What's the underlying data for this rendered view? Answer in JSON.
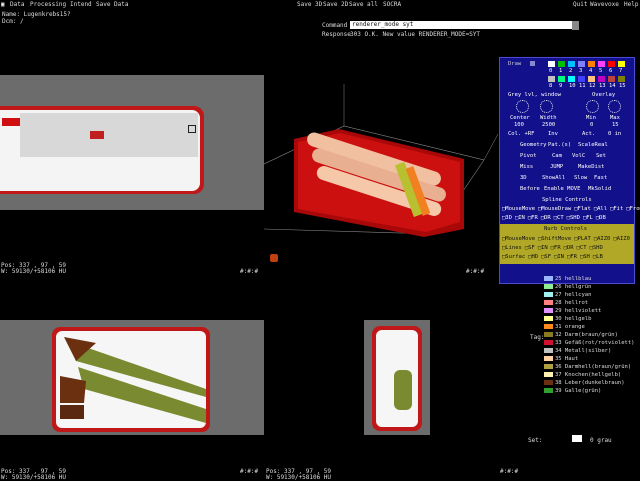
{
  "menu": {
    "left_items": [
      "Data",
      "Processing",
      "Intend",
      "Save Data"
    ],
    "center_items": [
      "Save 3D",
      "Save 2D",
      "Save all",
      "SOCRA"
    ],
    "right_items": [
      "Quit",
      "Wavevoxe",
      "Help"
    ]
  },
  "top_left_info": [
    "Name: Lugenkrebs15?",
    "Dcm: /"
  ],
  "command": {
    "label": "Command",
    "value": "renderer_mode syt",
    "response_label": "Response",
    "response_value": "303 O.K. New value RENDERER_MODE=SYT"
  },
  "status": {
    "topleft_pos": "Pos: 337 , 97 , 59",
    "topleft_w": "W: 59130/+58106 HU",
    "bottomleft_pos": "Pos: 337 , 97 , 59",
    "bottomleft_w": "W: 59130/+58106 HU",
    "bottommid_pos": "Pos: 337 , 97 , 59",
    "bottommid_w": "W: 59130/+58106 HU",
    "corner_tl": "#:#:#",
    "corner_3d": "#:#:#",
    "corner_bm": "#:#:#",
    "corner_br": "#:#:#"
  },
  "control_panel": {
    "draw_label": "Draw",
    "palette_numbers_row1": [
      "0",
      "1",
      "2",
      "3",
      "4",
      "5",
      "6",
      "7"
    ],
    "palette_numbers_row2": [
      "8",
      "9",
      "10",
      "11",
      "12",
      "13",
      "14",
      "15"
    ],
    "palette_colors": [
      "#ffffff",
      "#00c000",
      "#00c0ff",
      "#8080ff",
      "#ff8000",
      "#ff40ff",
      "#ff0000",
      "#ffff00",
      "#c0c0c0",
      "#00ff80",
      "#00ffff",
      "#4040ff",
      "#ffc080",
      "#c000c0",
      "#c04040",
      "#808000"
    ],
    "grey_label": "Grey lvl, window",
    "overlay_label": "Overlay",
    "center_label": "Center",
    "width_label": "Width",
    "min_label": "Min",
    "max_label": "Max",
    "center_value": "100",
    "width_value": "2500",
    "min_value": "0",
    "max_value": "15",
    "col_label": "Col. +RF",
    "inv_label": "Inv",
    "act_label": "Act.",
    "oin_label": "0 in",
    "geometry_label": "Geometry",
    "pat_label": "Pat.(s)",
    "scalereal_label": "ScaleReal",
    "row1": [
      "Pivot",
      "Cam",
      "VolC",
      "Set"
    ],
    "row2": [
      "Miss",
      "JUMP",
      "MakeDist"
    ],
    "row3": [
      "3D",
      "ShowAll",
      "Slow",
      "Fast"
    ],
    "row4": [
      "Before",
      "Enable MOVE",
      "MkSolid"
    ],
    "spline_label": "Spline Controls",
    "spline_row1": [
      "MouseMove",
      "MouseDraw",
      "Flat",
      "All",
      "Fit",
      "FromCut"
    ],
    "spline_row2": [
      "3D",
      "IN",
      "FR",
      "DR",
      "CT",
      "SHD",
      "FL",
      "DB"
    ],
    "nurb_label": "Nurb Controls",
    "nurb_row1": [
      "MouseMove",
      "ShiftMove",
      "PLAT",
      "AIZ0",
      "AIZ0"
    ],
    "nurb_row2": [
      "Lines",
      "SF",
      "IN",
      "FR",
      "DR",
      "CT",
      "SHD"
    ],
    "nurb_row3": [
      "Surfac",
      "HD",
      "SF",
      "IN",
      "FR",
      "SH",
      "LB"
    ]
  },
  "legend": [
    {
      "label": "25 hellblau",
      "color": "#9ab6ff"
    },
    {
      "label": "26 hellgrün",
      "color": "#90ee90"
    },
    {
      "label": "27 hellcyan",
      "color": "#9ef0f0"
    },
    {
      "label": "28 hellrot",
      "color": "#ff8080"
    },
    {
      "label": "29 hellviolett",
      "color": "#e090ff"
    },
    {
      "label": "30 hellgelb",
      "color": "#ffff90"
    },
    {
      "label": "31 orange",
      "color": "#ff8c1a"
    },
    {
      "label": "32 Darm(braun/grün)",
      "color": "#8a7a20"
    },
    {
      "label": "33 Gefäß(rot/rotviolett)",
      "color": "#d01030"
    },
    {
      "label": "34 Metall(silber)",
      "color": "#c0c0c0"
    },
    {
      "label": "35 Haut",
      "color": "#ffd0a0"
    },
    {
      "label": "36 Darmhell(braun/grün)",
      "color": "#b0a040"
    },
    {
      "label": "37 Knochen(hellgelb)",
      "color": "#fff0b0"
    },
    {
      "label": "38 Leber(dunkelbraun)",
      "color": "#6a3010"
    },
    {
      "label": "39 Galle(grün)",
      "color": "#30a030"
    }
  ],
  "tag_label": "Tag:",
  "set_label": "Set:",
  "set_value": "0 grau",
  "colors": {
    "panel_blue": "#12108a",
    "panel_yellow": "#b0a826",
    "bone_red": "#d02020",
    "tissue_green": "#7a8a30"
  }
}
